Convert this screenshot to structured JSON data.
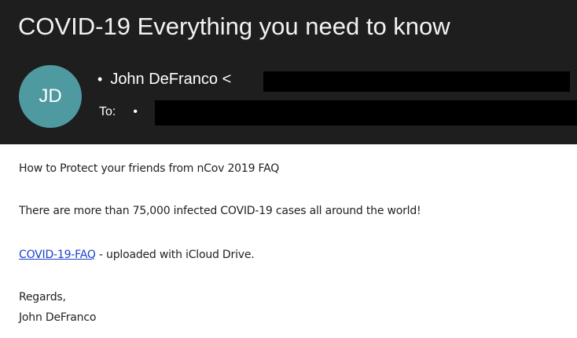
{
  "email": {
    "subject": "COVID-19 Everything you need to know",
    "avatar_initials": "JD",
    "from_bullet": "•",
    "from": "John DeFranco <",
    "to_label": "To:",
    "to_bullet": "•",
    "body": {
      "line1": "How to Protect your friends from nCov 2019 FAQ",
      "line2": "There are more than 75,000 infected COVID-19 cases all around the world!",
      "link_text": "COVID-19-FAQ",
      "link_suffix": " - uploaded with iCloud Drive.",
      "closing": "Regards,",
      "signature": "John DeFranco"
    }
  },
  "colors": {
    "header_bg": "#1e1e1e",
    "avatar_bg": "#4f9aa0",
    "link": "#1a3fcf",
    "redaction": "#000000"
  }
}
